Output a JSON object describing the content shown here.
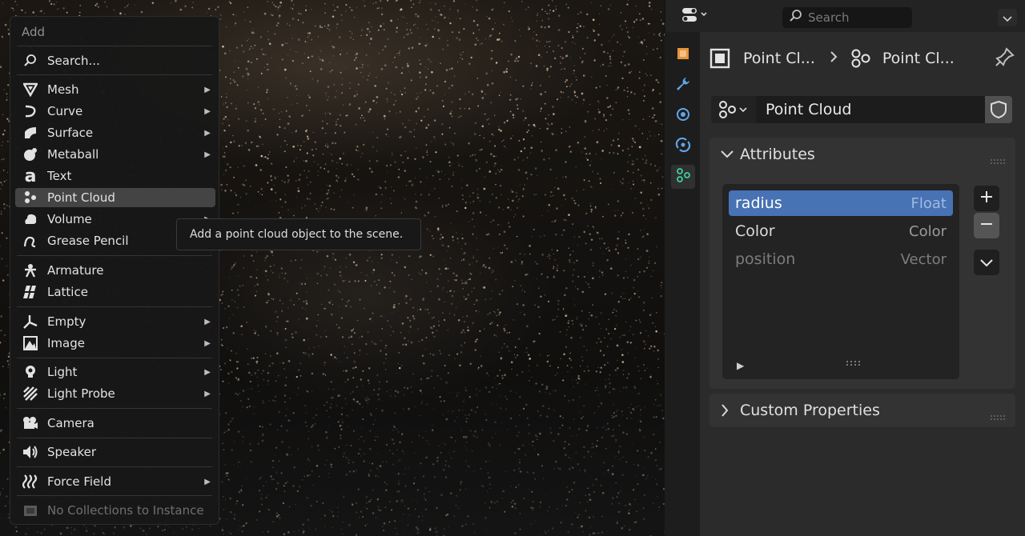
{
  "add_menu": {
    "title": "Add",
    "search_label": "Search...",
    "items": [
      {
        "label": "Mesh",
        "submenu": true
      },
      {
        "label": "Curve",
        "submenu": true
      },
      {
        "label": "Surface",
        "submenu": true
      },
      {
        "label": "Metaball",
        "submenu": true
      },
      {
        "label": "Text",
        "submenu": false
      },
      {
        "label": "Point Cloud",
        "submenu": false,
        "selected": true
      },
      {
        "label": "Volume",
        "submenu": true
      },
      {
        "label": "Grease Pencil",
        "submenu": true
      },
      {
        "label": "Armature",
        "submenu": false
      },
      {
        "label": "Lattice",
        "submenu": false
      },
      {
        "label": "Empty",
        "submenu": true
      },
      {
        "label": "Image",
        "submenu": true
      },
      {
        "label": "Light",
        "submenu": true
      },
      {
        "label": "Light Probe",
        "submenu": true
      },
      {
        "label": "Camera",
        "submenu": false
      },
      {
        "label": "Speaker",
        "submenu": false
      },
      {
        "label": "Force Field",
        "submenu": true
      },
      {
        "label": "No Collections to Instance",
        "submenu": false,
        "disabled": true
      }
    ],
    "tooltip": "Add a point cloud object to the scene."
  },
  "properties": {
    "search_placeholder": "Search",
    "breadcrumb": {
      "object": "Point Cl...",
      "data": "Point Cl..."
    },
    "datablock_name": "Point Cloud",
    "attributes_panel": {
      "title": "Attributes",
      "rows": [
        {
          "name": "radius",
          "type": "Float",
          "selected": true
        },
        {
          "name": "Color",
          "type": "Color"
        },
        {
          "name": "position",
          "type": "Vector",
          "dim": true
        }
      ]
    },
    "custom_properties_title": "Custom Properties"
  },
  "colors": {
    "selection_blue": "#4772b3",
    "object_orange": "#e6953a",
    "data_green": "#3fcf9a",
    "physics_blue": "#5fa6e8"
  }
}
